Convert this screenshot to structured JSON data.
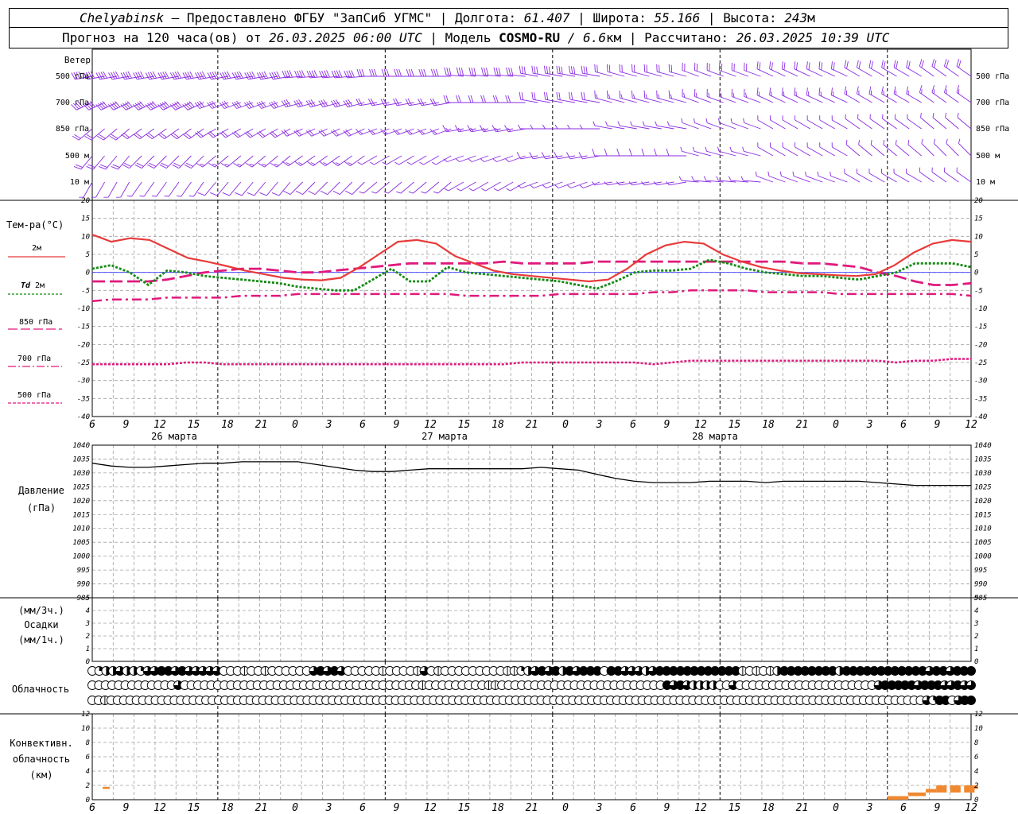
{
  "header": {
    "station": "Chelyabinsk",
    "dash": " – ",
    "provider": "Предоставлено ФГБУ \"ЗапСиб УГМС\"",
    "sep": " | ",
    "lon_label": "Долгота: ",
    "lon_value": "61.407",
    "lat_label": "Широта: ",
    "lat_value": "55.166",
    "alt_label": "Высота: ",
    "alt_value": "243",
    "alt_unit": "м",
    "forecast_label": "Прогноз на 120 часа(ов) от ",
    "forecast_time": "26.03.2025 06:00 UTC",
    "model_label": "  | Модель ",
    "model_name": "COSMO-RU",
    "model_slash": " / ",
    "model_res": "6.6",
    "model_res_unit": "км",
    "calc_label": " | Рассчитано: ",
    "calc_time": "26.03.2025 10:39 UTC"
  },
  "labels": {
    "wind": "Ветер",
    "wind_levels": [
      "500 гПа",
      "700 гПа",
      "850 гПа",
      "500 м",
      "10  м"
    ],
    "temp": "Тем-ра(°C)",
    "t2m": "2м",
    "td_symbol": "Td",
    "td_level": " 2м",
    "t850": "850 гПа",
    "t700": "700 гПа",
    "t500": "500 гПа",
    "pressure": "Давление",
    "pressure_unit": "(гПа)",
    "precip_unit3": "(мм/3ч.)",
    "precip": "Осадки",
    "precip_unit1": "(мм/1ч.)",
    "cloud": "Облачность",
    "conv1": "Конвективн.",
    "conv2": "облачность",
    "conv3": "(км)"
  },
  "colors": {
    "wind": "#8a2be2",
    "t2m": "#e83a3a",
    "td": "#138a13",
    "t850": "#e0197d",
    "zero_line": "#3a3aff",
    "pressure": "#000000",
    "conv": "#f08830",
    "grid": "#a0a0a0"
  },
  "chart_data": {
    "type": "meteogram",
    "x_ticks": [
      "6",
      "9",
      "12",
      "15",
      "18",
      "21",
      "0",
      "3",
      "6",
      "9",
      "12",
      "15",
      "18",
      "21",
      "0",
      "3",
      "6",
      "9",
      "12",
      "15",
      "18",
      "21",
      "0",
      "3",
      "6",
      "9",
      "12"
    ],
    "day_labels": [
      "26 марта",
      "27 марта",
      "28 марта"
    ],
    "temperature": {
      "ylim": [
        -40,
        20
      ],
      "yticks": [
        20,
        15,
        10,
        5,
        0,
        -5,
        -10,
        -15,
        -20,
        -25,
        -30,
        -35,
        -40
      ],
      "t2m": [
        10.5,
        8.5,
        9.5,
        9.0,
        6.5,
        4.0,
        3.0,
        1.8,
        0.5,
        -0.5,
        -1.5,
        -2.0,
        -2.2,
        -1.5,
        1.5,
        5.0,
        8.5,
        9.0,
        8.0,
        4.5,
        2.5,
        0.5,
        -0.5,
        -1.0,
        -1.5,
        -2.0,
        -2.5,
        -2.0,
        1.0,
        5.0,
        7.5,
        8.5,
        8.0,
        5.0,
        3.0,
        1.5,
        0.5,
        -0.2,
        -0.5,
        -0.8,
        -1.0,
        -0.5,
        2.0,
        5.5,
        8.0,
        9.0,
        8.5
      ],
      "td2m": [
        1.0,
        2.0,
        0.0,
        -3.5,
        0.5,
        0.0,
        -1.0,
        -1.5,
        -2.0,
        -2.5,
        -3.0,
        -4.0,
        -4.5,
        -5.0,
        -5.0,
        -2.0,
        1.0,
        -2.5,
        -2.5,
        1.5,
        0.0,
        -0.5,
        -1.0,
        -1.5,
        -2.0,
        -2.5,
        -3.5,
        -4.5,
        -2.5,
        0.0,
        0.5,
        0.5,
        1.0,
        3.5,
        2.5,
        1.0,
        0.0,
        -0.5,
        -1.0,
        -1.0,
        -1.5,
        -2.0,
        -1.0,
        0.0,
        2.5,
        2.5,
        2.5,
        1.5
      ],
      "t850": [
        -2.5,
        -2.5,
        -2.5,
        -2.5,
        -2.0,
        -1.0,
        0.0,
        0.5,
        1.0,
        1.0,
        0.5,
        0.0,
        0.0,
        0.5,
        1.0,
        1.5,
        2.0,
        2.5,
        2.5,
        2.5,
        2.5,
        2.5,
        3.0,
        2.5,
        2.5,
        2.5,
        2.5,
        3.0,
        3.0,
        3.0,
        3.0,
        3.0,
        3.0,
        3.0,
        3.0,
        3.0,
        3.0,
        3.0,
        2.5,
        2.5,
        2.0,
        1.5,
        0.0,
        -1.0,
        -2.5,
        -3.5,
        -3.5,
        -3.0
      ],
      "t700": [
        -8.0,
        -7.5,
        -7.5,
        -7.5,
        -7.0,
        -7.0,
        -7.0,
        -7.0,
        -6.5,
        -6.5,
        -6.5,
        -6.0,
        -6.0,
        -6.0,
        -6.0,
        -6.0,
        -6.0,
        -6.0,
        -6.0,
        -6.0,
        -6.5,
        -6.5,
        -6.5,
        -6.5,
        -6.5,
        -6.0,
        -6.0,
        -6.0,
        -6.0,
        -6.0,
        -5.5,
        -5.5,
        -5.0,
        -5.0,
        -5.0,
        -5.0,
        -5.5,
        -5.5,
        -5.5,
        -5.5,
        -6.0,
        -6.0,
        -6.0,
        -6.0,
        -6.0,
        -6.0,
        -6.0,
        -6.5
      ],
      "t500": [
        -25.5,
        -25.5,
        -25.5,
        -25.5,
        -25.5,
        -25.0,
        -25.0,
        -25.5,
        -25.5,
        -25.5,
        -25.5,
        -25.5,
        -25.5,
        -25.5,
        -25.5,
        -25.5,
        -25.5,
        -25.5,
        -25.5,
        -25.5,
        -25.5,
        -25.5,
        -25.5,
        -25.0,
        -25.0,
        -25.0,
        -25.0,
        -25.0,
        -25.0,
        -25.0,
        -25.5,
        -25.0,
        -24.5,
        -24.5,
        -24.5,
        -24.5,
        -24.5,
        -24.5,
        -24.5,
        -24.5,
        -24.5,
        -24.5,
        -24.5,
        -25.0,
        -24.5,
        -24.5,
        -24.0,
        -24.0
      ]
    },
    "pressure": {
      "ylim": [
        985,
        1040
      ],
      "yticks": [
        1040,
        1035,
        1030,
        1025,
        1020,
        1015,
        1010,
        1005,
        1000,
        995,
        990,
        985
      ],
      "values": [
        1033.5,
        1032.5,
        1032.0,
        1032.0,
        1032.5,
        1033.0,
        1033.5,
        1033.5,
        1034.0,
        1034.0,
        1034.0,
        1034.0,
        1033.0,
        1032.0,
        1031.0,
        1030.5,
        1030.5,
        1031.0,
        1031.5,
        1031.5,
        1031.5,
        1031.5,
        1031.5,
        1031.5,
        1032.0,
        1031.5,
        1031.0,
        1029.5,
        1028.0,
        1027.0,
        1026.5,
        1026.5,
        1026.5,
        1027.0,
        1027.0,
        1027.0,
        1026.5,
        1027.0,
        1027.0,
        1027.0,
        1027.0,
        1027.0,
        1026.5,
        1026.0,
        1025.5,
        1025.5,
        1025.5,
        1025.5
      ]
    },
    "precipitation": {
      "ylim": [
        0,
        5
      ],
      "yticks": [
        5,
        4,
        3,
        2,
        1,
        0
      ],
      "values": []
    },
    "convective_cloud": {
      "ylim": [
        0,
        12
      ],
      "yticks": [
        12,
        10,
        8,
        6,
        4,
        2,
        0
      ],
      "bars": [
        {
          "x": 1.5,
          "w": 1.0,
          "bottom": 1.5,
          "top": 1.8
        },
        {
          "x": 114.0,
          "w": 3.0,
          "bottom": 0.0,
          "top": 0.5
        },
        {
          "x": 117.0,
          "w": 2.5,
          "bottom": 0.5,
          "top": 1.0
        },
        {
          "x": 119.5,
          "w": 1.5,
          "bottom": 1.0,
          "top": 1.5
        },
        {
          "x": 121.0,
          "w": 1.5,
          "bottom": 1.0,
          "top": 2.0
        },
        {
          "x": 123.0,
          "w": 1.5,
          "bottom": 1.0,
          "top": 2.0
        },
        {
          "x": 125.0,
          "w": 1.5,
          "bottom": 1.0,
          "top": 2.0
        },
        {
          "x": 126.0,
          "w": 1.0,
          "bottom": 1.5,
          "top": 2.0
        }
      ]
    },
    "cloud_cover": {
      "rows": [
        [
          0,
          3,
          4,
          4,
          6,
          4,
          4,
          3,
          6,
          6,
          8,
          8,
          6,
          8,
          6,
          6,
          7,
          6,
          6,
          0,
          0,
          0,
          1,
          0,
          0,
          1,
          0,
          0,
          0,
          0,
          0,
          0,
          6,
          8,
          6,
          8,
          7,
          0,
          0,
          0,
          0,
          0,
          1,
          0,
          0,
          0,
          0,
          1,
          6,
          0,
          1,
          0,
          0,
          0,
          0,
          0,
          0,
          0,
          0,
          0,
          1,
          1,
          3,
          5,
          6,
          8,
          6,
          8,
          5,
          8,
          7,
          8,
          8,
          8,
          0,
          8,
          8,
          7,
          6,
          6,
          5,
          6,
          8,
          8,
          8,
          8,
          8,
          8,
          8,
          8,
          8,
          8,
          8,
          8,
          1,
          0,
          1,
          0,
          1,
          4,
          8,
          8,
          8,
          8,
          8,
          8,
          8,
          8,
          4,
          8,
          8,
          8,
          8,
          8,
          8,
          8,
          8,
          8,
          8,
          8,
          8,
          6,
          8,
          8,
          6,
          8,
          8,
          8
        ],
        [
          0,
          0,
          0,
          0,
          0,
          0,
          0,
          0,
          0,
          0,
          0,
          0,
          0,
          6,
          0,
          0,
          0,
          0,
          0,
          0,
          0,
          0,
          0,
          0,
          0,
          0,
          0,
          0,
          0,
          0,
          0,
          0,
          0,
          0,
          0,
          0,
          0,
          0,
          0,
          0,
          0,
          0,
          0,
          0,
          0,
          0,
          0,
          0,
          0,
          0,
          1,
          0,
          0,
          0,
          0,
          0,
          0,
          0,
          0,
          0,
          1,
          1,
          0,
          0,
          0,
          0,
          0,
          0,
          0,
          0,
          0,
          0,
          0,
          0,
          0,
          0,
          0,
          0,
          0,
          0,
          0,
          0,
          0,
          0,
          0,
          0,
          0,
          8,
          6,
          8,
          6,
          4,
          4,
          4,
          4,
          0,
          0,
          6,
          0,
          0,
          0,
          0,
          0,
          0,
          0,
          0,
          0,
          0,
          0,
          0,
          0,
          0,
          0,
          0,
          0,
          0,
          0,
          0,
          0,
          6,
          8,
          8,
          8,
          8,
          8,
          6,
          8,
          8,
          8,
          6,
          6,
          8,
          6,
          6
        ],
        [
          0,
          0,
          1,
          0,
          0,
          0,
          0,
          0,
          0,
          0,
          0,
          0,
          0,
          0,
          0,
          0,
          0,
          0,
          0,
          0,
          0,
          0,
          0,
          0,
          0,
          0,
          0,
          0,
          0,
          0,
          0,
          0,
          0,
          0,
          0,
          0,
          0,
          0,
          0,
          0,
          0,
          0,
          0,
          0,
          0,
          0,
          0,
          0,
          0,
          0,
          0,
          0,
          0,
          0,
          0,
          0,
          0,
          0,
          0,
          0,
          0,
          0,
          0,
          0,
          0,
          0,
          0,
          0,
          0,
          0,
          0,
          0,
          0,
          0,
          0,
          0,
          0,
          0,
          0,
          0,
          0,
          0,
          0,
          0,
          0,
          0,
          0,
          0,
          0,
          0,
          0,
          0,
          0,
          0,
          0,
          0,
          0,
          0,
          0,
          0,
          0,
          0,
          0,
          0,
          0,
          0,
          0,
          0,
          0,
          0,
          0,
          0,
          0,
          0,
          0,
          0,
          0,
          0,
          0,
          0,
          0,
          0,
          0,
          0,
          0,
          0,
          0,
          0,
          0,
          0,
          0,
          0,
          6,
          3,
          8,
          8,
          0,
          6,
          8,
          8
        ]
      ]
    },
    "wind": {
      "levels": [
        "500 гПа",
        "700 гПа",
        "850 гПа",
        "500 м",
        "10  м"
      ],
      "direction_deg": [
        [
          260,
          260,
          260,
          265,
          270,
          275,
          280,
          285,
          290,
          295,
          300,
          305
        ],
        [
          245,
          245,
          250,
          255,
          260,
          270,
          280,
          285,
          290,
          295,
          300,
          305
        ],
        [
          230,
          235,
          240,
          245,
          250,
          260,
          270,
          280,
          290,
          300,
          305,
          310
        ],
        [
          220,
          225,
          230,
          235,
          240,
          250,
          260,
          270,
          285,
          300,
          310,
          315
        ],
        [
          210,
          215,
          220,
          225,
          230,
          240,
          250,
          260,
          275,
          290,
          300,
          305
        ]
      ],
      "speed_ms": [
        [
          22,
          22,
          20,
          18,
          16,
          14,
          14,
          12,
          12,
          10,
          10,
          10
        ],
        [
          18,
          18,
          16,
          14,
          12,
          10,
          10,
          8,
          8,
          8,
          8,
          8
        ],
        [
          12,
          12,
          10,
          10,
          8,
          8,
          6,
          6,
          6,
          6,
          6,
          6
        ],
        [
          10,
          10,
          8,
          8,
          6,
          6,
          5,
          5,
          4,
          4,
          4,
          4
        ],
        [
          6,
          6,
          5,
          5,
          4,
          4,
          3,
          3,
          3,
          3,
          3,
          3
        ]
      ]
    }
  }
}
